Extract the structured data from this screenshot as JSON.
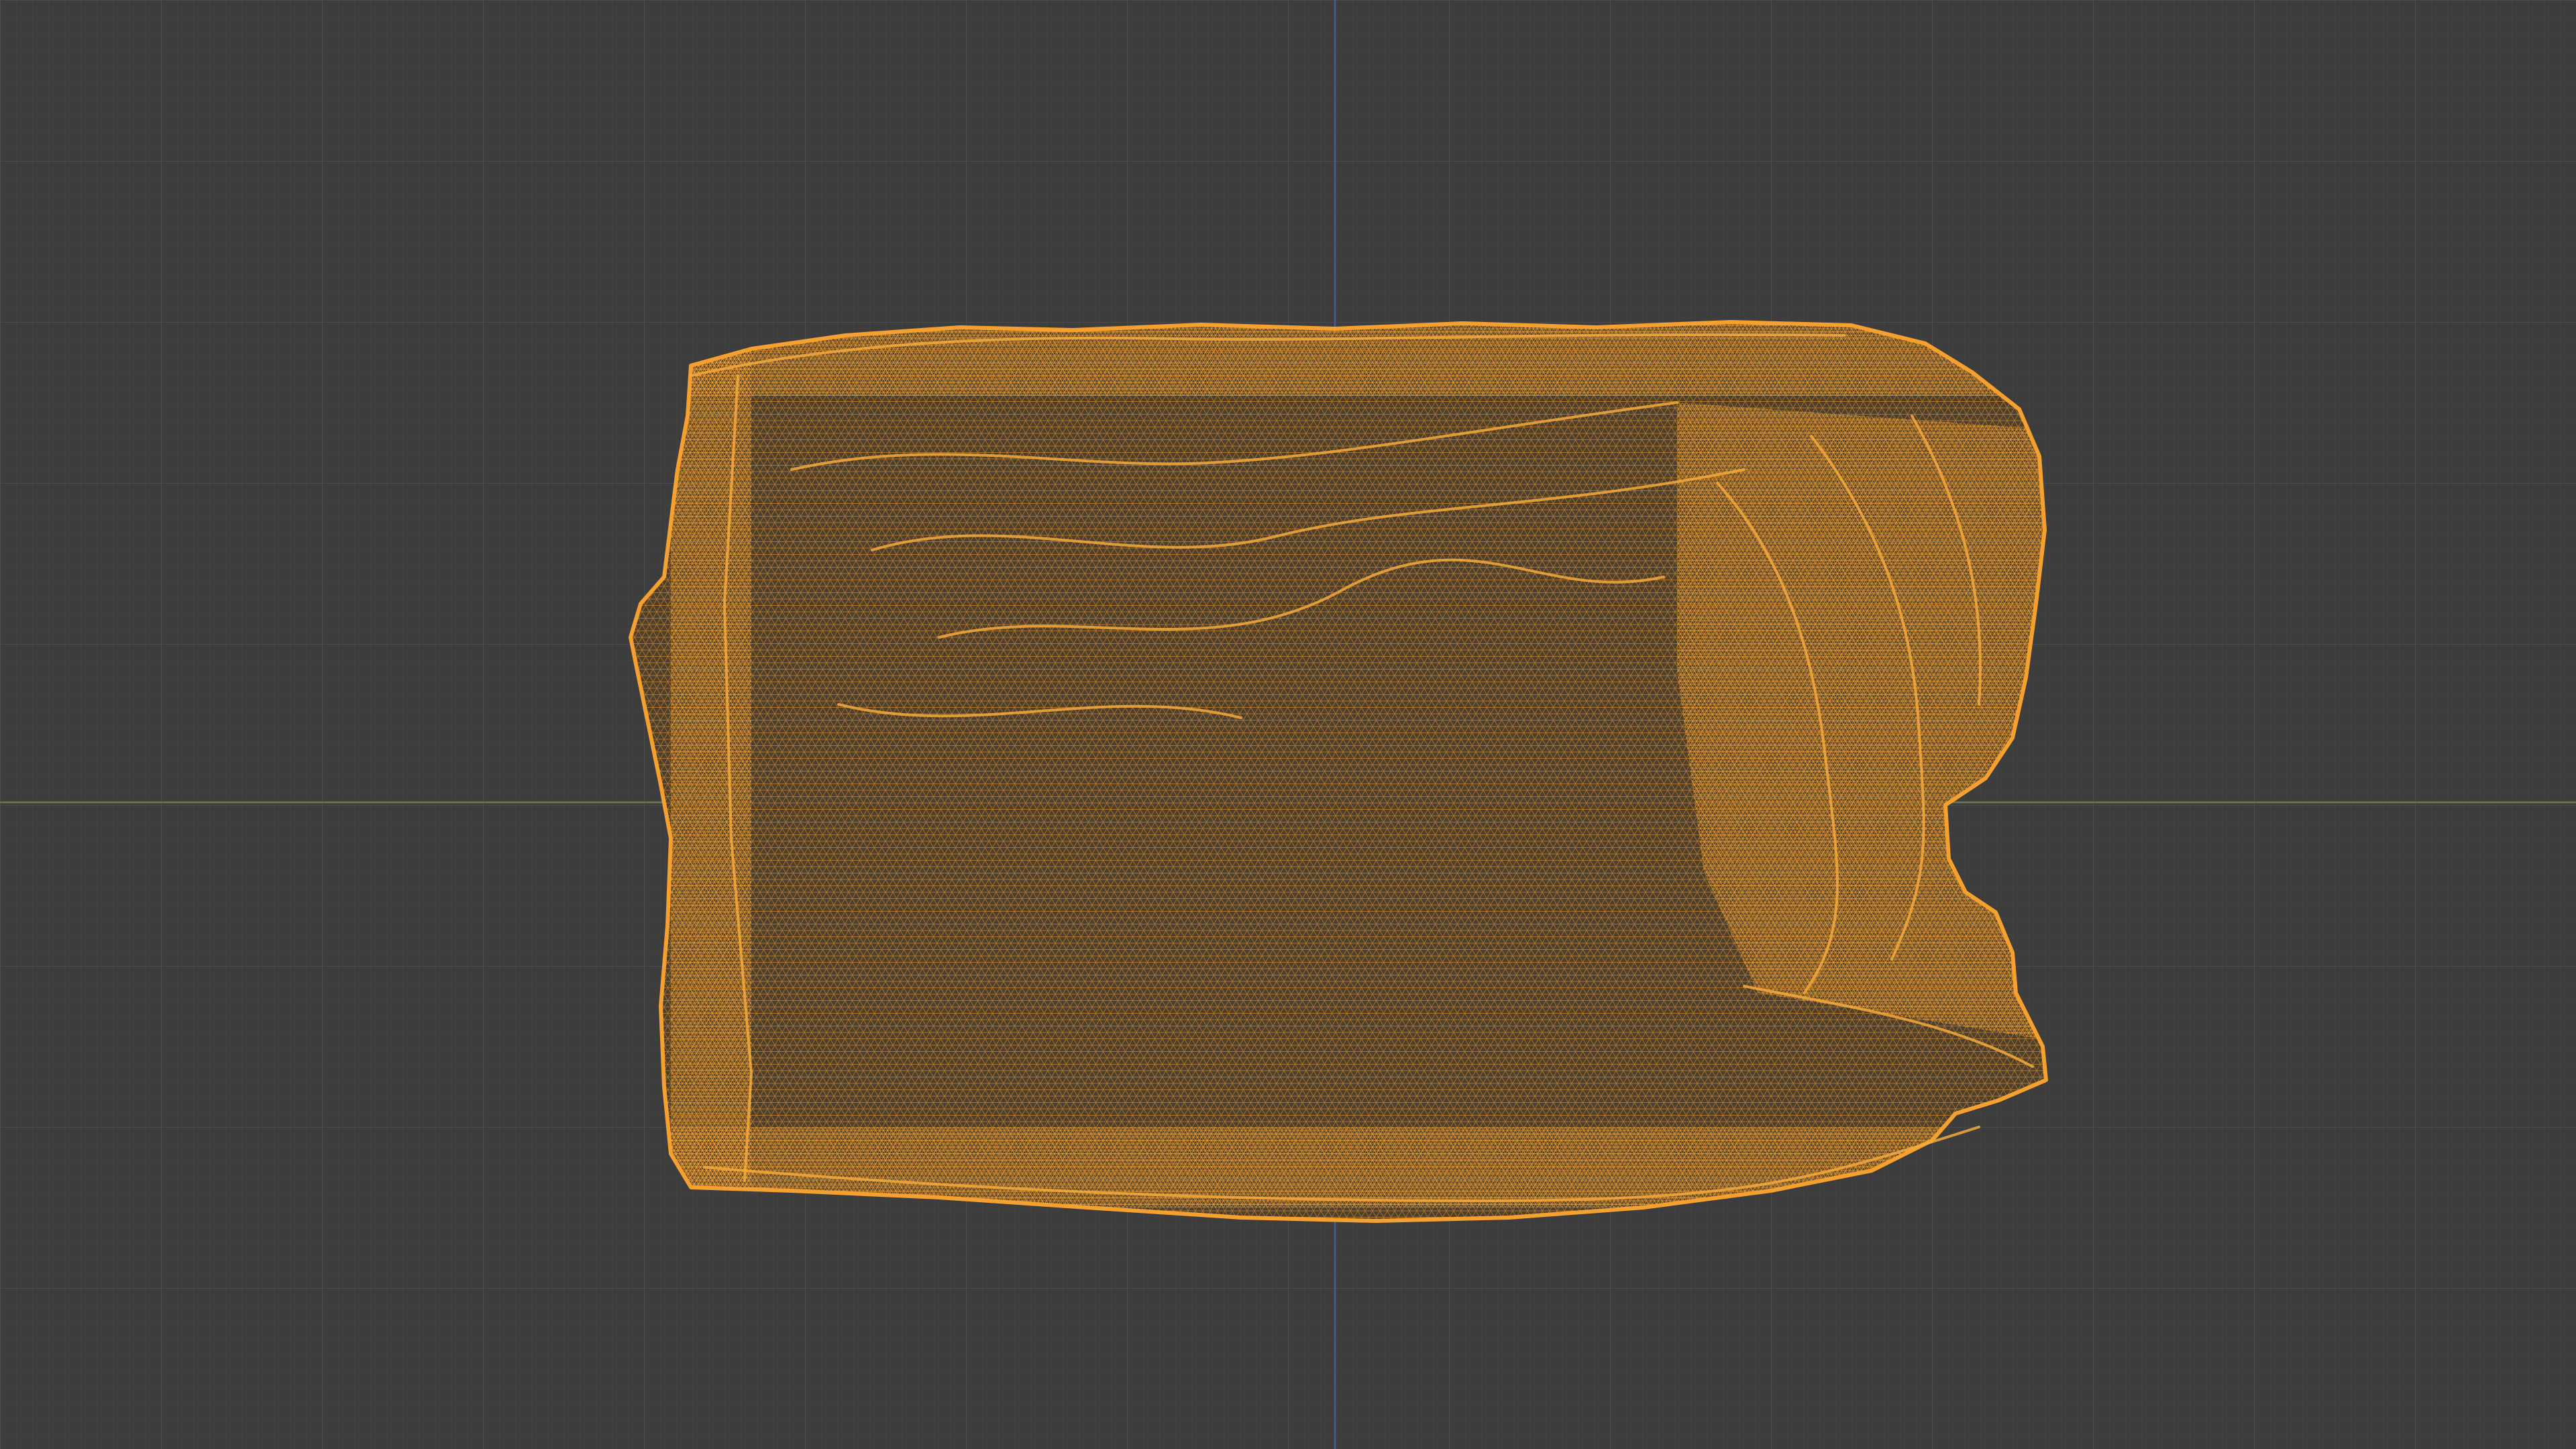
{
  "viewport": {
    "mode": "wireframe",
    "background_color": "#3d3d3d",
    "grid_minor_color": "#454545",
    "grid_major_color": "#4b4b4b",
    "axis_x_color": "#6f7a4a",
    "axis_y_color": "#3f5f8f",
    "selection_color": "#f5a02f",
    "selection_fill_color": "#7a5320"
  },
  "object": {
    "name_icon": "mesh-icon",
    "state": "selected",
    "display": "wireframe"
  }
}
